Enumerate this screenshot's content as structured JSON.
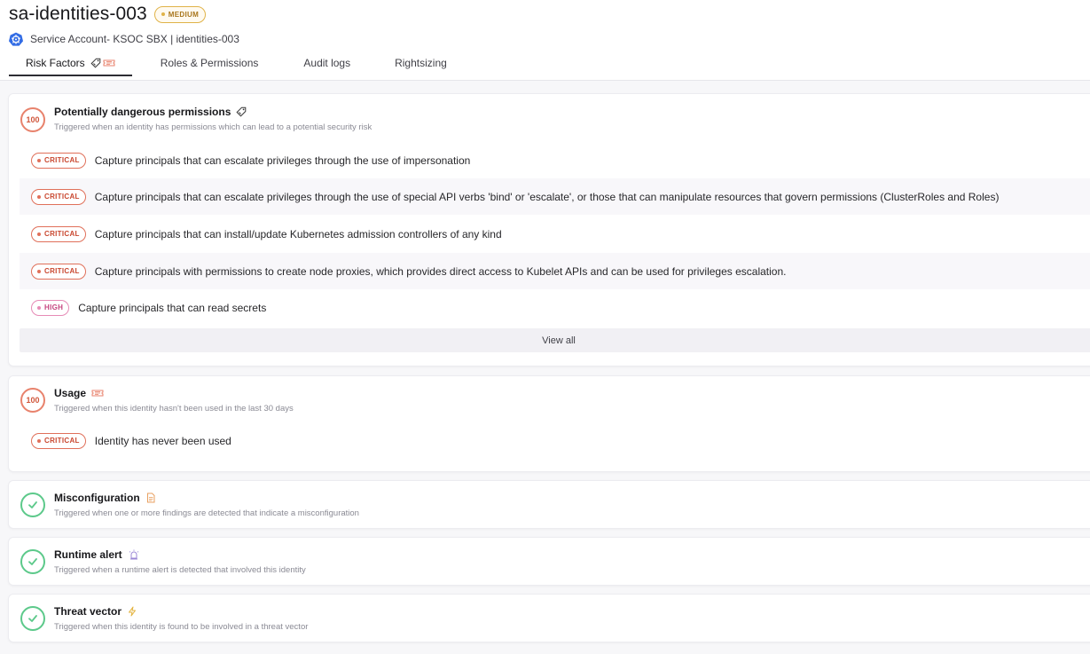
{
  "header": {
    "title": "sa-identities-003",
    "risk_badge": "MEDIUM",
    "subtitle": "Service Account- KSOC SBX | identities-003"
  },
  "tabs": [
    {
      "label": "Risk Factors",
      "active": true
    },
    {
      "label": "Roles & Permissions",
      "active": false
    },
    {
      "label": "Audit logs",
      "active": false
    },
    {
      "label": "Rightsizing",
      "active": false
    }
  ],
  "cards": {
    "permissions": {
      "score": "100",
      "title": "Potentially dangerous permissions",
      "description": "Triggered when an identity has permissions which can lead to a potential security risk",
      "findings": [
        {
          "severity": "CRITICAL",
          "text": "Capture principals that can escalate privileges through the use of impersonation"
        },
        {
          "severity": "CRITICAL",
          "text": "Capture principals that can escalate privileges through the use of special API verbs 'bind' or 'escalate', or those that can manipulate resources that govern permissions (ClusterRoles and Roles)"
        },
        {
          "severity": "CRITICAL",
          "text": "Capture principals that can install/update Kubernetes admission controllers of any kind"
        },
        {
          "severity": "CRITICAL",
          "text": "Capture principals with permissions to create node proxies, which provides direct access to Kubelet APIs and can be used for privileges escalation."
        },
        {
          "severity": "HIGH",
          "text": "Capture principals that can read secrets"
        }
      ],
      "view_all_label": "View all"
    },
    "usage": {
      "score": "100",
      "title": "Usage",
      "description": "Triggered when this identity hasn't been used in the last 30 days",
      "findings": [
        {
          "severity": "CRITICAL",
          "text": "Identity has never been used"
        }
      ]
    },
    "misconfiguration": {
      "title": "Misconfiguration",
      "description": "Triggered when one or more findings are detected that indicate a misconfiguration"
    },
    "runtime": {
      "title": "Runtime alert",
      "description": "Triggered when a runtime alert is detected that involved this identity"
    },
    "threat": {
      "title": "Threat vector",
      "description": "Triggered when this identity is found to be involved in a threat vector"
    }
  },
  "colors": {
    "critical": "#e0705a",
    "high": "#e68bb6",
    "medium": "#e0b348",
    "ok": "#5cc98a"
  },
  "icons": {
    "permissions": "key-tag-icon",
    "usage": "ticket-icon",
    "misconfiguration": "document-icon",
    "runtime": "siren-icon",
    "threat": "lightning-icon",
    "service_account": "kubernetes-icon",
    "passed": "check-icon"
  }
}
